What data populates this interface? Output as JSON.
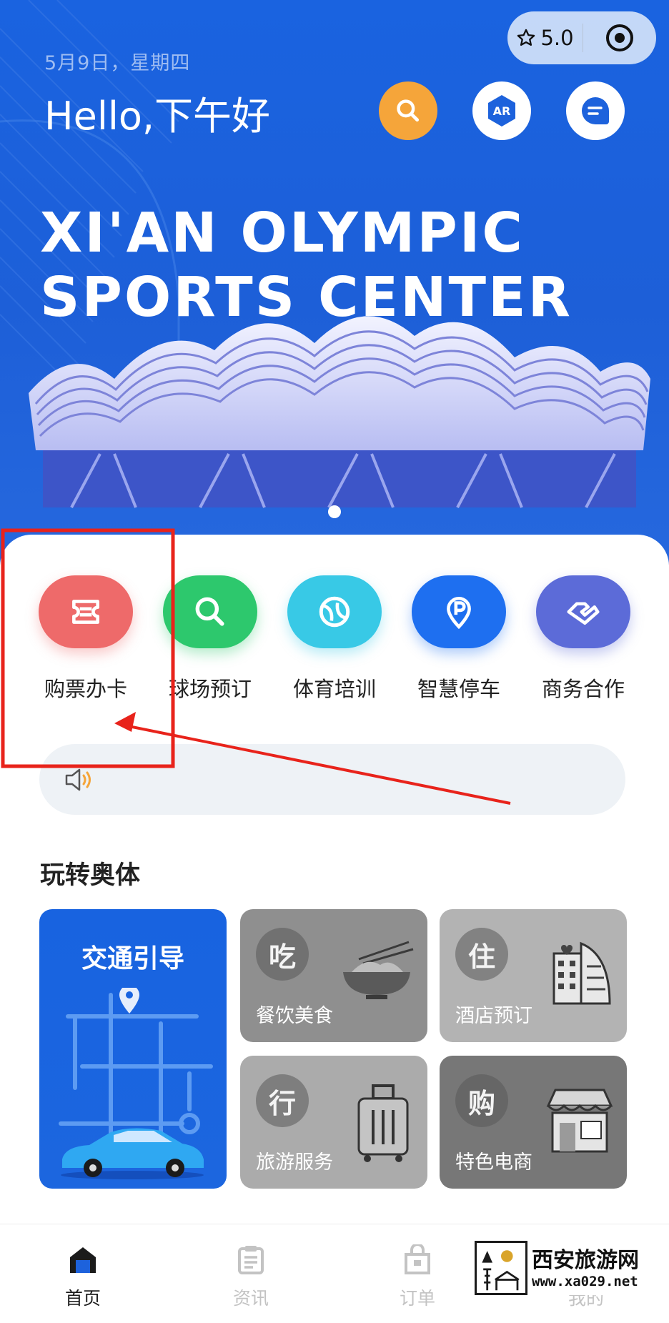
{
  "header": {
    "date": "5月9日，星期四",
    "greeting": "Hello,下午好",
    "capsule": {
      "rating": "5.0"
    },
    "buttons": {
      "search": "search-icon",
      "ar": "AR",
      "message": "message-icon"
    }
  },
  "banner": {
    "title_line1": "XI'AN OLYMPIC",
    "title_line2": "SPORTS CENTER",
    "active_slide": 1,
    "slide_count": 1
  },
  "quick_actions": [
    {
      "label": "购票办卡",
      "icon": "ticket-icon",
      "color": "#ee6a6a"
    },
    {
      "label": "球场预订",
      "icon": "search-icon",
      "color": "#2dc86d"
    },
    {
      "label": "体育培训",
      "icon": "ball-icon",
      "color": "#38c9e6"
    },
    {
      "label": "智慧停车",
      "icon": "parking-icon",
      "color": "#1e6ff0"
    },
    {
      "label": "商务合作",
      "icon": "handshake-icon",
      "color": "#5c6bd8"
    }
  ],
  "notice": {
    "icon": "speaker-icon",
    "text": ""
  },
  "section": {
    "title": "玩转奥体",
    "tiles": {
      "traffic": {
        "title": "交通引导"
      },
      "food": {
        "badge": "吃",
        "label": "餐饮美食"
      },
      "hotel": {
        "badge": "住",
        "label": "酒店预订"
      },
      "travel": {
        "badge": "行",
        "label": "旅游服务"
      },
      "shop": {
        "badge": "购",
        "label": "特色电商"
      }
    }
  },
  "tabbar": [
    {
      "label": "首页",
      "icon": "home-icon",
      "active": true
    },
    {
      "label": "资讯",
      "icon": "news-icon",
      "active": false
    },
    {
      "label": "订单",
      "icon": "order-bag-icon",
      "active": false
    },
    {
      "label": "我的",
      "icon": "user-icon",
      "active": false
    }
  ],
  "watermark": {
    "title": "西安旅游网",
    "url": "www.xa029.net"
  },
  "colors": {
    "primary": "#1d62dc",
    "accent": "#f5a53a",
    "annotation": "#e8231b"
  }
}
